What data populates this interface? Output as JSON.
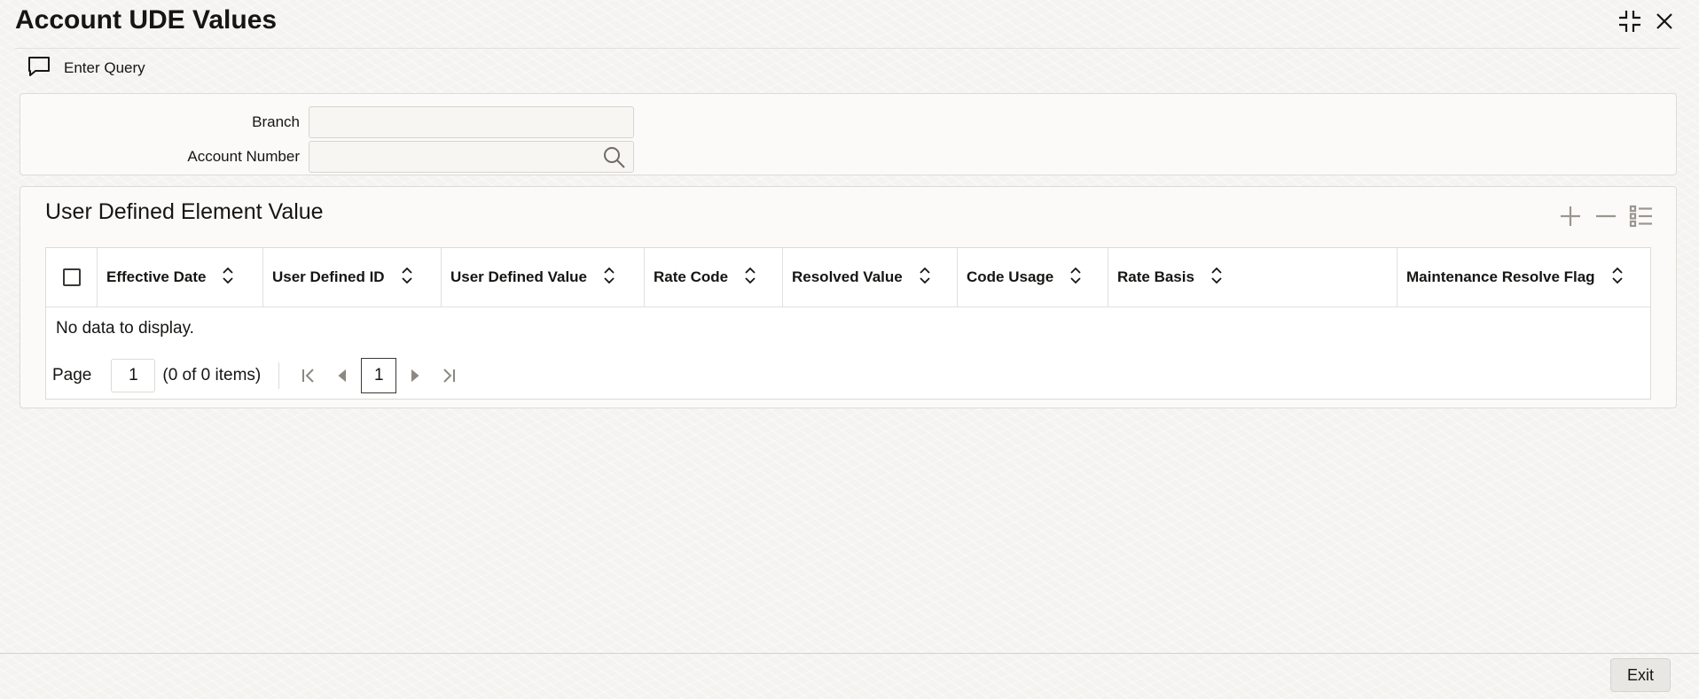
{
  "window": {
    "title": "Account UDE Values",
    "minimize_icon": "collapse-icon",
    "close_icon": "close-icon"
  },
  "toolbar": {
    "enter_query_label": "Enter Query",
    "enter_query_icon": "speech-bubble-icon"
  },
  "query": {
    "branch_label": "Branch",
    "branch_value": "",
    "account_label": "Account Number",
    "account_value": ""
  },
  "grid": {
    "title": "User Defined Element Value",
    "columns": [
      "Effective Date",
      "User Defined ID",
      "User Defined Value",
      "Rate Code",
      "Resolved Value",
      "Code Usage",
      "Rate Basis",
      "Maintenance Resolve Flag"
    ],
    "empty_text": "No data to display.",
    "pager": {
      "page_label": "Page",
      "page_value": "1",
      "items_text": "(0 of 0 items)",
      "current_page": "1"
    }
  },
  "footer": {
    "exit_label": "Exit"
  }
}
